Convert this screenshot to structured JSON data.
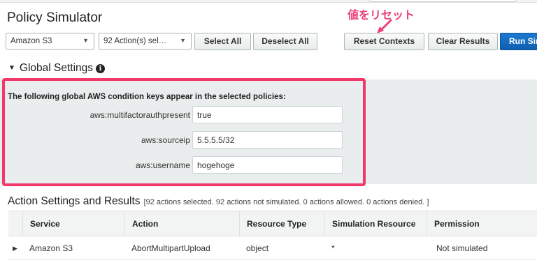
{
  "page": {
    "title": "Policy Simulator"
  },
  "annotation": {
    "text": "値をリセット",
    "color": "#ea3f7a"
  },
  "toolbar": {
    "service_select": "Amazon S3",
    "actions_select": "92 Action(s) sel…",
    "select_all": "Select All",
    "deselect_all": "Deselect All",
    "reset_contexts": "Reset Contexts",
    "clear_results": "Clear Results",
    "run_simulation": "Run Sir"
  },
  "global_settings": {
    "heading": "Global Settings",
    "caption": "The following global AWS condition keys appear in the selected policies:",
    "keys": [
      {
        "label": "aws:multifactorauthpresent",
        "value": "true"
      },
      {
        "label": "aws:sourceip",
        "value": "5.5.5.5/32"
      },
      {
        "label": "aws:username",
        "value": "hogehoge"
      }
    ]
  },
  "results": {
    "heading": "Action Settings and Results",
    "summary": "[92 actions selected. 92 actions not simulated. 0 actions allowed. 0 actions denied. ]",
    "columns": [
      "Service",
      "Action",
      "Resource Type",
      "Simulation Resource",
      "Permission"
    ],
    "rows": [
      {
        "service": "Amazon S3",
        "action": "AbortMultipartUpload",
        "resource_type": "object",
        "simulation_resource": "*",
        "permission": "Not simulated"
      }
    ]
  },
  "colors": {
    "highlight": "#f0386b",
    "primary": "#0f5fb0",
    "panel": "#eaeded"
  },
  "icons": {
    "info": "info-icon",
    "collapse": "triangle-down-icon",
    "expand": "triangle-right-icon",
    "dropdown": "caret-down-icon"
  }
}
